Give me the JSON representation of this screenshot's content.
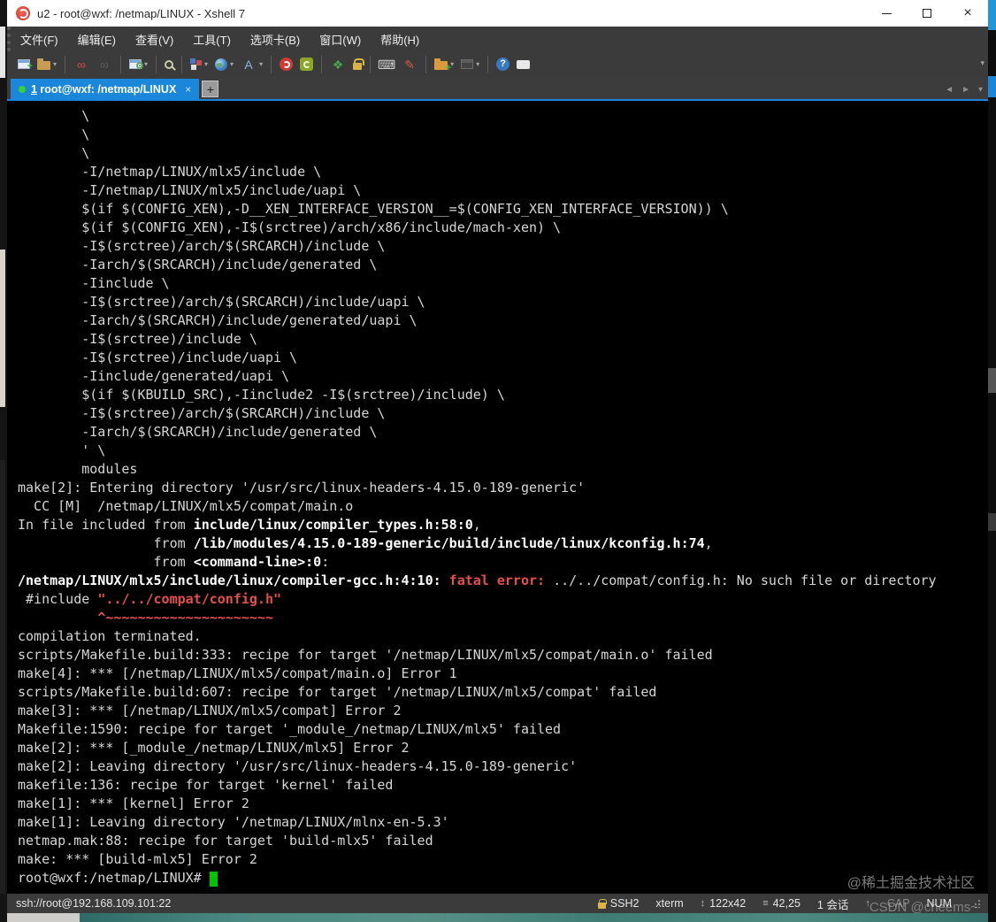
{
  "window": {
    "title": "u2 - root@wxf: /netmap/LINUX - Xshell 7",
    "controls": {
      "minimize": "minimize",
      "maximize": "maximize",
      "close": "×"
    }
  },
  "menu": {
    "items": [
      "文件(F)",
      "编辑(E)",
      "查看(V)",
      "工具(T)",
      "选项卡(B)",
      "窗口(W)",
      "帮助(H)"
    ]
  },
  "toolbar": {
    "groups": [
      [
        {
          "name": "new-session",
          "kind": "k-window",
          "overlay": "+",
          "overlay_color": "#3fb53f"
        },
        {
          "name": "open-session",
          "kind": "k-folder",
          "color": "#c99c54",
          "caret": true
        }
      ],
      [
        {
          "name": "reconnect",
          "kind": "glyph",
          "glyph": "∞",
          "color": "#c94b46"
        },
        {
          "name": "disconnect",
          "kind": "glyph",
          "glyph": "∞",
          "color": "#5d5d5d"
        }
      ],
      [
        {
          "name": "session-properties",
          "kind": "k-window",
          "overlay": "⚙",
          "overlay_color": "#58a058",
          "caret": true
        }
      ],
      [
        {
          "name": "find",
          "kind": "k-magnifier"
        }
      ],
      [
        {
          "name": "color-scheme",
          "kind": "k-colors",
          "caret": true
        },
        {
          "name": "web-browser",
          "kind": "k-globe",
          "caret": true
        },
        {
          "name": "font",
          "kind": "glyph",
          "glyph": "A",
          "color": "#8fb2e0",
          "caret": true
        }
      ],
      [
        {
          "name": "xshell-app",
          "kind": "k-xshell"
        },
        {
          "name": "xftp-app",
          "kind": "k-xftp"
        }
      ],
      [
        {
          "name": "fullscreen",
          "kind": "glyph",
          "glyph": "❖",
          "color": "#46a546"
        },
        {
          "name": "lock-screen",
          "kind": "k-lock"
        }
      ],
      [
        {
          "name": "virtual-keyboard",
          "kind": "glyph",
          "glyph": "⌨",
          "color": "#cfcfcf"
        },
        {
          "name": "compose-pen",
          "kind": "glyph",
          "glyph": "✎",
          "color": "#d85545"
        }
      ],
      [
        {
          "name": "file-transfer",
          "kind": "k-folder",
          "color": "#d99b3e",
          "overlay": "+",
          "overlay_color": "#3fb53f",
          "caret": true
        },
        {
          "name": "transfer-disabled",
          "kind": "k-window-dim",
          "caret": true
        }
      ],
      [
        {
          "name": "help",
          "kind": "k-help",
          "glyph": "?"
        },
        {
          "name": "feedback-chat",
          "kind": "k-bubble"
        }
      ]
    ],
    "overflow_caret": "▾"
  },
  "tabbar": {
    "active_tab": {
      "number": "1",
      "label": " root@wxf: /netmap/LINUX",
      "close": "×"
    },
    "new_tab": "+",
    "nav_left": "◄",
    "nav_right": "►",
    "nav_more": "▾"
  },
  "terminal": {
    "lines": [
      [
        [
          "d",
          "        \\"
        ]
      ],
      [
        [
          "d",
          "        \\"
        ]
      ],
      [
        [
          "d",
          "        \\"
        ]
      ],
      [
        [
          "d",
          "        -I/netmap/LINUX/mlx5/include \\"
        ]
      ],
      [
        [
          "d",
          "        -I/netmap/LINUX/mlx5/include/uapi \\"
        ]
      ],
      [
        [
          "d",
          "        $(if $(CONFIG_XEN),-D__XEN_INTERFACE_VERSION__=$(CONFIG_XEN_INTERFACE_VERSION)) \\"
        ]
      ],
      [
        [
          "d",
          "        $(if $(CONFIG_XEN),-I$(srctree)/arch/x86/include/mach-xen) \\"
        ]
      ],
      [
        [
          "d",
          "        -I$(srctree)/arch/$(SRCARCH)/include \\"
        ]
      ],
      [
        [
          "d",
          "        -Iarch/$(SRCARCH)/include/generated \\"
        ]
      ],
      [
        [
          "d",
          "        -Iinclude \\"
        ]
      ],
      [
        [
          "d",
          "        -I$(srctree)/arch/$(SRCARCH)/include/uapi \\"
        ]
      ],
      [
        [
          "d",
          "        -Iarch/$(SRCARCH)/include/generated/uapi \\"
        ]
      ],
      [
        [
          "d",
          "        -I$(srctree)/include \\"
        ]
      ],
      [
        [
          "d",
          "        -I$(srctree)/include/uapi \\"
        ]
      ],
      [
        [
          "d",
          "        -Iinclude/generated/uapi \\"
        ]
      ],
      [
        [
          "d",
          "        $(if $(KBUILD_SRC),-Iinclude2 -I$(srctree)/include) \\"
        ]
      ],
      [
        [
          "d",
          "        -I$(srctree)/arch/$(SRCARCH)/include \\"
        ]
      ],
      [
        [
          "d",
          "        -Iarch/$(SRCARCH)/include/generated \\"
        ]
      ],
      [
        [
          "d",
          "        ' \\"
        ]
      ],
      [
        [
          "d",
          "        modules"
        ]
      ],
      [
        [
          "d",
          "make[2]: Entering directory '/usr/src/linux-headers-4.15.0-189-generic'"
        ]
      ],
      [
        [
          "d",
          "  CC [M]  /netmap/LINUX/mlx5/compat/main.o"
        ]
      ],
      [
        [
          "d",
          "In file included from "
        ],
        [
          "b",
          "include/linux/compiler_types.h:58:0"
        ],
        [
          "d",
          ","
        ]
      ],
      [
        [
          "d",
          "                 from "
        ],
        [
          "b",
          "/lib/modules/4.15.0-189-generic/build/include/linux/kconfig.h:74"
        ],
        [
          "d",
          ","
        ]
      ],
      [
        [
          "d",
          "                 from "
        ],
        [
          "b",
          "<command-line>:0"
        ],
        [
          "d",
          ":"
        ]
      ],
      [
        [
          "b",
          "/netmap/LINUX/mlx5/include/linux/compiler-gcc.h:4:10:"
        ],
        [
          "d",
          " "
        ],
        [
          "r",
          "fatal error:"
        ],
        [
          "d",
          " ../../compat/config.h: No such file or directory"
        ]
      ],
      [
        [
          "d",
          " #include "
        ],
        [
          "r",
          "\"../../compat/config.h\""
        ]
      ],
      [
        [
          "d",
          "          "
        ],
        [
          "r",
          "^~~~~~~~~~~~~~~~~~~~~~"
        ]
      ],
      [
        [
          "d",
          "compilation terminated."
        ]
      ],
      [
        [
          "d",
          "scripts/Makefile.build:333: recipe for target '/netmap/LINUX/mlx5/compat/main.o' failed"
        ]
      ],
      [
        [
          "d",
          "make[4]: *** [/netmap/LINUX/mlx5/compat/main.o] Error 1"
        ]
      ],
      [
        [
          "d",
          "scripts/Makefile.build:607: recipe for target '/netmap/LINUX/mlx5/compat' failed"
        ]
      ],
      [
        [
          "d",
          "make[3]: *** [/netmap/LINUX/mlx5/compat] Error 2"
        ]
      ],
      [
        [
          "d",
          "Makefile:1590: recipe for target '_module_/netmap/LINUX/mlx5' failed"
        ]
      ],
      [
        [
          "d",
          "make[2]: *** [_module_/netmap/LINUX/mlx5] Error 2"
        ]
      ],
      [
        [
          "d",
          "make[2]: Leaving directory '/usr/src/linux-headers-4.15.0-189-generic'"
        ]
      ],
      [
        [
          "d",
          "makefile:136: recipe for target 'kernel' failed"
        ]
      ],
      [
        [
          "d",
          "make[1]: *** [kernel] Error 2"
        ]
      ],
      [
        [
          "d",
          "make[1]: Leaving directory '/netmap/LINUX/mlnx-en-5.3'"
        ]
      ],
      [
        [
          "d",
          "netmap.mak:88: recipe for target 'build-mlx5' failed"
        ]
      ],
      [
        [
          "d",
          "make: *** [build-mlx5] Error 2"
        ]
      ],
      [
        [
          "d",
          "root@wxf:/netmap/LINUX# "
        ],
        [
          "cur",
          " "
        ]
      ]
    ],
    "colors": {
      "background": "#000000",
      "foreground": "#d6d6d6",
      "bold": "#ffffff",
      "error_red": "#e5504e",
      "cursor_green": "#00c400"
    }
  },
  "statusbar": {
    "connection": "ssh://root@192.168.109.101:22",
    "items": [
      {
        "name": "protocol",
        "icon": "lock",
        "label": "SSH2"
      },
      {
        "name": "terminal-type",
        "label": "xterm"
      },
      {
        "name": "terminal-size",
        "icon": "resize",
        "label": "122x42"
      },
      {
        "name": "cursor-position",
        "icon": "pos",
        "label": "42,25"
      },
      {
        "name": "session-count",
        "label": "1 会话"
      },
      {
        "name": "scroll-up",
        "icon": "up",
        "label": ""
      },
      {
        "name": "caps-indicator",
        "label": "CAP",
        "dim": true
      },
      {
        "name": "num-indicator",
        "label": "NUM"
      }
    ],
    "icon_glyphs": {
      "resize": "↕",
      "pos": "≡",
      "up": "↑"
    }
  },
  "watermarks": {
    "juejin": "@稀土掘金技术社区",
    "csdn": "CSDN @cheems~"
  }
}
